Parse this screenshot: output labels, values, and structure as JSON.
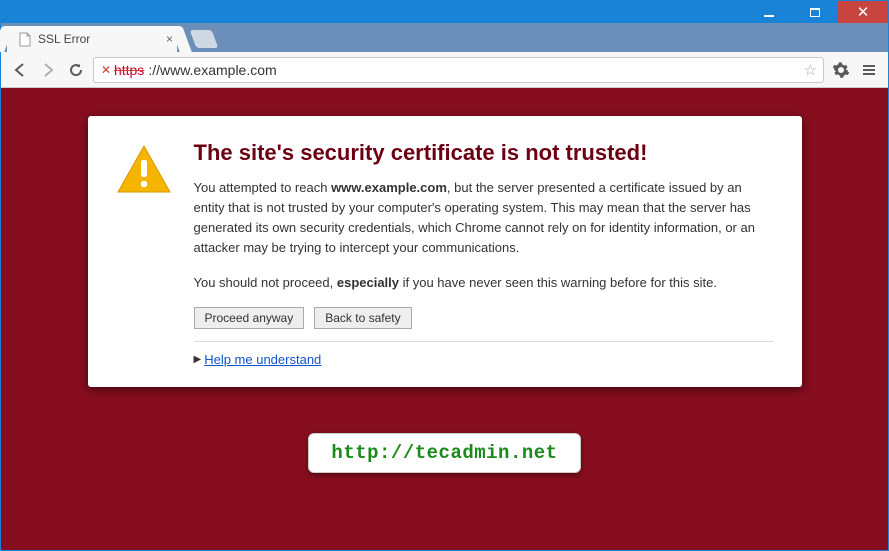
{
  "tab": {
    "title": "SSL Error"
  },
  "url": {
    "scheme_struck": "https",
    "rest": "://www.example.com"
  },
  "card": {
    "heading": "The site's security certificate is not trusted!",
    "para1_a": "You attempted to reach ",
    "para1_b": "www.example.com",
    "para1_c": ", but the server presented a certificate issued by an entity that is not trusted by your computer's operating system. This may mean that the server has generated its own security credentials, which Chrome cannot rely on for identity information, or an attacker may be trying to intercept your communications.",
    "para2_a": "You should not proceed, ",
    "para2_b": "especially",
    "para2_c": " if you have never seen this warning before for this site.",
    "proceed_label": "Proceed anyway",
    "back_label": "Back to safety",
    "help_label": "Help me understand"
  },
  "badge": {
    "text": "http://tecadmin.net"
  }
}
